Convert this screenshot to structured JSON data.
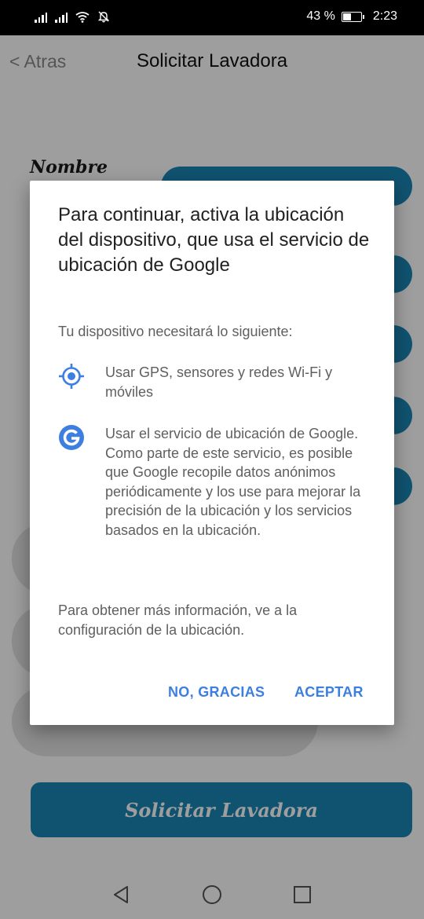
{
  "status_bar": {
    "battery_text": "43 %",
    "battery_level": 0.43,
    "time": "2:23",
    "icons": [
      "signal-icon",
      "signal-icon",
      "wifi-icon",
      "bell-off-icon",
      "battery-icon"
    ]
  },
  "header": {
    "back_label": "< Atras",
    "title": "Solicitar Lavadora"
  },
  "form": {
    "name_label": "Nombre",
    "submit_label": "Solicitar Lavadora"
  },
  "dialog": {
    "title": "Para continuar, activa la ubicación del dispositivo, que usa el servicio de ubicación de Google",
    "subtitle": "Tu dispositivo necesitará lo siguiente:",
    "items": [
      {
        "icon": "gps-target-icon",
        "text": "Usar GPS, sensores y redes Wi-Fi y móviles"
      },
      {
        "icon": "google-g-icon",
        "text": "Usar el servicio de ubicación de Google. Como parte de este servicio, es posible que Google recopile datos anónimos periódicamente y los use para mejorar la precisión de la ubicación y los servicios basados en la ubicación."
      }
    ],
    "footer": "Para obtener más información, ve a la configuración de la ubicación.",
    "buttons": {
      "decline": "NO, GRACIAS",
      "accept": "ACEPTAR"
    }
  },
  "colors": {
    "accent": "#1b87b5",
    "dialog_button": "#3d7fe0",
    "gps_icon": "#3d7fe0"
  },
  "nav_bar": {
    "icons": [
      "back-triangle-icon",
      "home-circle-icon",
      "recents-square-icon"
    ]
  }
}
